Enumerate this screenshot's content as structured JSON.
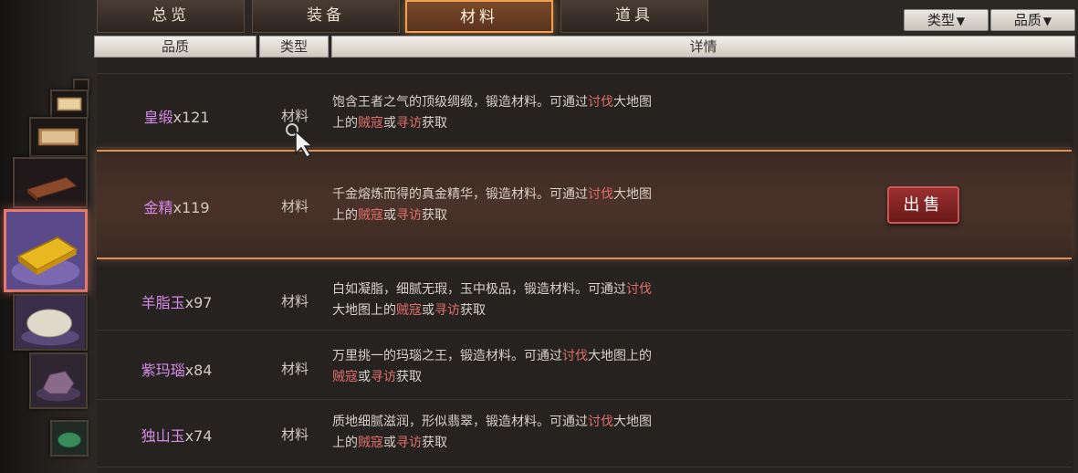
{
  "tabs": [
    {
      "label": "总览"
    },
    {
      "label": "装备"
    },
    {
      "label": "材料",
      "active": true
    },
    {
      "label": "道具"
    }
  ],
  "filters": {
    "type_label": "类型",
    "quality_label": "品质",
    "arrow": "▼"
  },
  "headers": {
    "quality": "品质",
    "type": "类型",
    "details": "详情"
  },
  "items": [
    {
      "name": "皇缎",
      "count": "x121",
      "type": "材料",
      "desc_parts": [
        "饱含王者之气的顶级绸缎，锻造材料。可通过",
        "讨伐",
        "大地图",
        "上的",
        "贼寇",
        "或",
        "寻访",
        "获取"
      ]
    },
    {
      "name": "金精",
      "count": "x119",
      "type": "材料",
      "desc_parts": [
        "千金熔炼而得的真金精华，锻造材料。可通过",
        "讨伐",
        "大地图",
        "上的",
        "贼寇",
        "或",
        "寻访",
        "获取"
      ],
      "selected": true,
      "sell_label": "出售"
    },
    {
      "name": "羊脂玉",
      "count": "x97",
      "type": "材料",
      "desc_parts": [
        "白如凝脂，细腻无瑕，玉中极品，锻造材料。可通过",
        "讨伐",
        "",
        "大地图上的",
        "贼寇",
        "或",
        "寻访",
        "获取"
      ]
    },
    {
      "name": "紫玛瑙",
      "count": "x84",
      "type": "材料",
      "desc_parts": [
        "万里挑一的玛瑙之王，锻造材料。可通过",
        "讨伐",
        "大地图上的",
        "",
        "贼寇",
        "或",
        "寻访",
        "获取"
      ]
    },
    {
      "name": "独山玉",
      "count": "x74",
      "type": "材料",
      "desc_parts": [
        "质地细腻滋润，形似翡翠，锻造材料。可通过",
        "讨伐",
        "大地图",
        "上的",
        "贼寇",
        "或",
        "寻访",
        "获取"
      ]
    }
  ],
  "icons": [
    "gold-ingot-icon",
    "white-jade-icon",
    "purple-agate-icon",
    "green-jade-icon",
    "silk-scroll-icon",
    "book-icon"
  ],
  "colors": {
    "item_name": "#d68be8",
    "highlight": "#e2706a",
    "active_tab_border": "#f0a050"
  }
}
